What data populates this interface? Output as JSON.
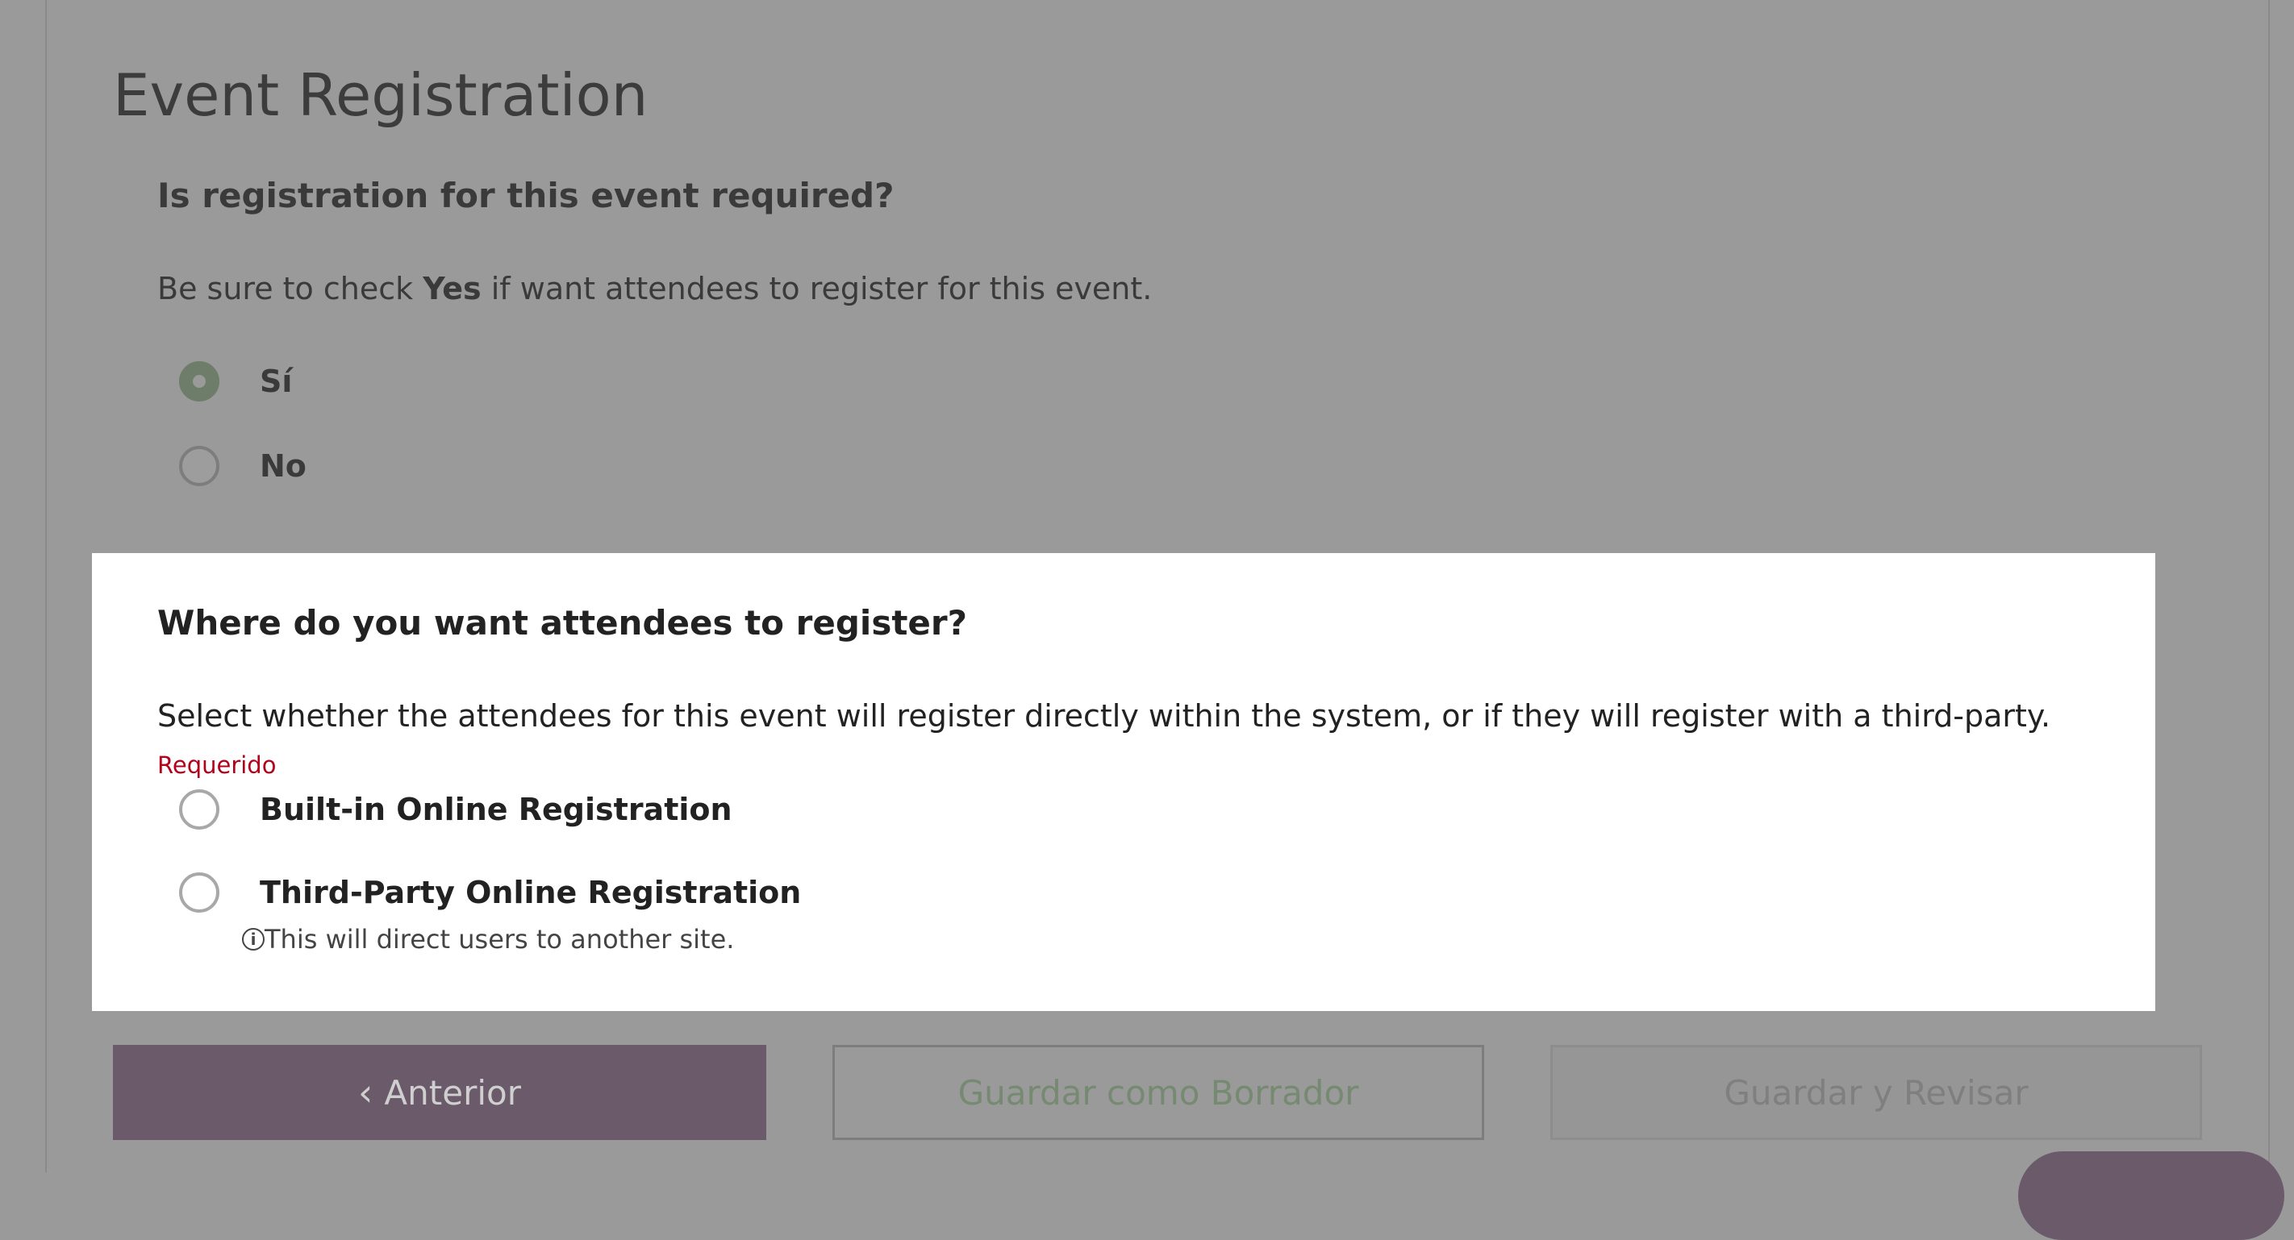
{
  "page": {
    "title": "Event Registration"
  },
  "question1": {
    "heading": "Is registration for this event required?",
    "desc_before": "Be sure to check ",
    "desc_bold": "Yes",
    "desc_after": " if want attendees to register for this event.",
    "options": [
      {
        "label": "Sí",
        "checked": true
      },
      {
        "label": "No",
        "checked": false
      }
    ]
  },
  "question2": {
    "heading": "Where do you want attendees to register?",
    "desc": "Select whether the attendees for this event will register directly within the system, or if they will register with a third-party.",
    "required_label": "Requerido",
    "options": [
      {
        "label": "Built-in Online Registration",
        "checked": false
      },
      {
        "label": "Third-Party Online Registration",
        "checked": false
      }
    ],
    "hint": "This will direct users to another site.",
    "hint_icon": "info-icon"
  },
  "footer": {
    "prev_label": "Anterior",
    "draft_label": "Guardar como Borrador",
    "review_label": "Guardar y Revisar"
  }
}
